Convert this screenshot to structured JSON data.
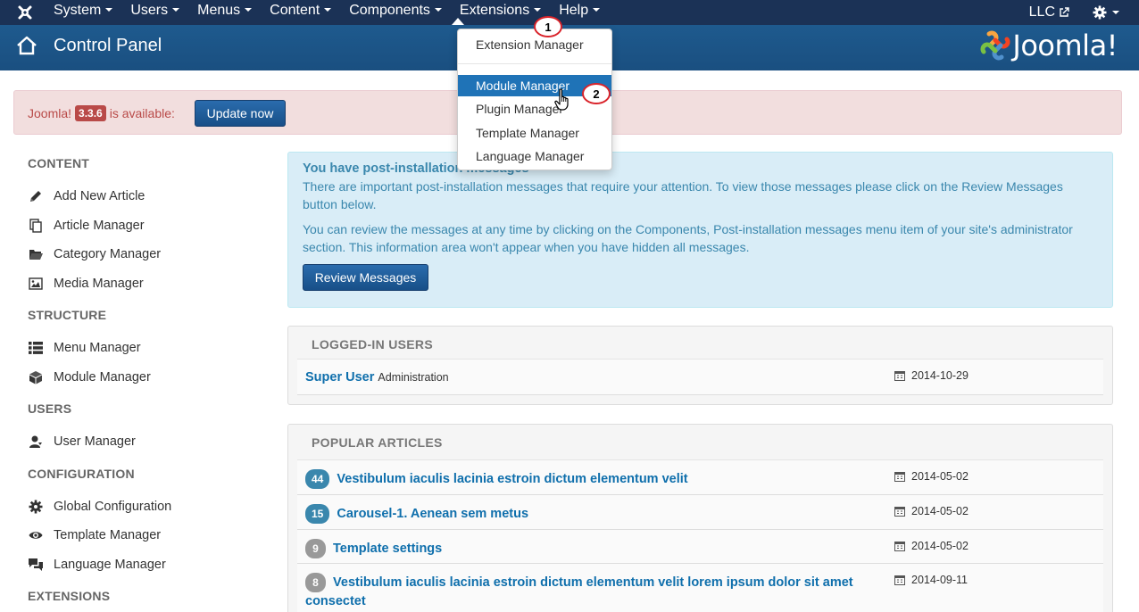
{
  "navbar": {
    "logo_icon": "joomla-star-icon",
    "menu": [
      {
        "label": "System"
      },
      {
        "label": "Users"
      },
      {
        "label": "Menus"
      },
      {
        "label": "Content"
      },
      {
        "label": "Components"
      },
      {
        "label": "Extensions"
      },
      {
        "label": "Help"
      }
    ],
    "site_label": "LLC",
    "settings_icon": "gear-icon"
  },
  "header": {
    "title": "Control Panel",
    "logo_text": "Joomla!"
  },
  "alert": {
    "prefix": "Joomla!",
    "version": "3.3.6",
    "suffix": "is available:",
    "update_button": "Update now"
  },
  "sidebar": {
    "sections": [
      {
        "heading": "Content",
        "items": [
          {
            "label": "Add New Article",
            "icon": "pencil-icon"
          },
          {
            "label": "Article Manager",
            "icon": "copy-icon"
          },
          {
            "label": "Category Manager",
            "icon": "folder-icon"
          },
          {
            "label": "Media Manager",
            "icon": "image-icon"
          }
        ]
      },
      {
        "heading": "Structure",
        "items": [
          {
            "label": "Menu Manager",
            "icon": "list-icon"
          },
          {
            "label": "Module Manager",
            "icon": "cube-icon"
          }
        ]
      },
      {
        "heading": "Users",
        "items": [
          {
            "label": "User Manager",
            "icon": "user-icon"
          }
        ]
      },
      {
        "heading": "Configuration",
        "items": [
          {
            "label": "Global Configuration",
            "icon": "cog-icon"
          },
          {
            "label": "Template Manager",
            "icon": "eye-icon"
          },
          {
            "label": "Language Manager",
            "icon": "comments-icon"
          }
        ]
      },
      {
        "heading": "Extensions",
        "items": []
      }
    ]
  },
  "postinstall": {
    "title": "You have post-installation messages",
    "p1": "There are important post-installation messages that require your attention. To view those messages please click on the Review Messages button below.",
    "p2": "You can review the messages at any time by clicking on the Components, Post-installation messages menu item of your site's administrator section. This information area won't appear when you have hidden all messages.",
    "button": "Review Messages"
  },
  "logged_users": {
    "heading": "Logged-in Users",
    "rows": [
      {
        "name": "Super User",
        "role": "Administration",
        "date": "2014-10-29"
      }
    ]
  },
  "popular_articles": {
    "heading": "Popular Articles",
    "rows": [
      {
        "hits": "44",
        "title": "Vestibulum iaculis lacinia estroin dictum elementum velit",
        "date": "2014-05-02"
      },
      {
        "hits": "15",
        "title": "Carousel-1. Aenean sem metus",
        "date": "2014-05-02"
      },
      {
        "hits": "9",
        "title": "Template settings",
        "date": "2014-05-02"
      },
      {
        "hits": "8",
        "title": "Vestibulum iaculis lacinia estroin dictum elementum velit lorem ipsum dolor sit amet consectet",
        "date": "2014-09-11"
      }
    ]
  },
  "extensions_menu": {
    "items": [
      {
        "label": "Extension Manager"
      },
      {
        "label": "Module Manager"
      },
      {
        "label": "Plugin Manager"
      },
      {
        "label": "Template Manager"
      },
      {
        "label": "Language Manager"
      }
    ],
    "selected": "Module Manager"
  },
  "annotations": {
    "step1": "1",
    "step2": "2"
  },
  "colors": {
    "navbar": "#1b3256",
    "header": "#1e5a8e",
    "link": "#0f6fac",
    "selected": "#1f73b7",
    "annotation": "#d9232a"
  }
}
